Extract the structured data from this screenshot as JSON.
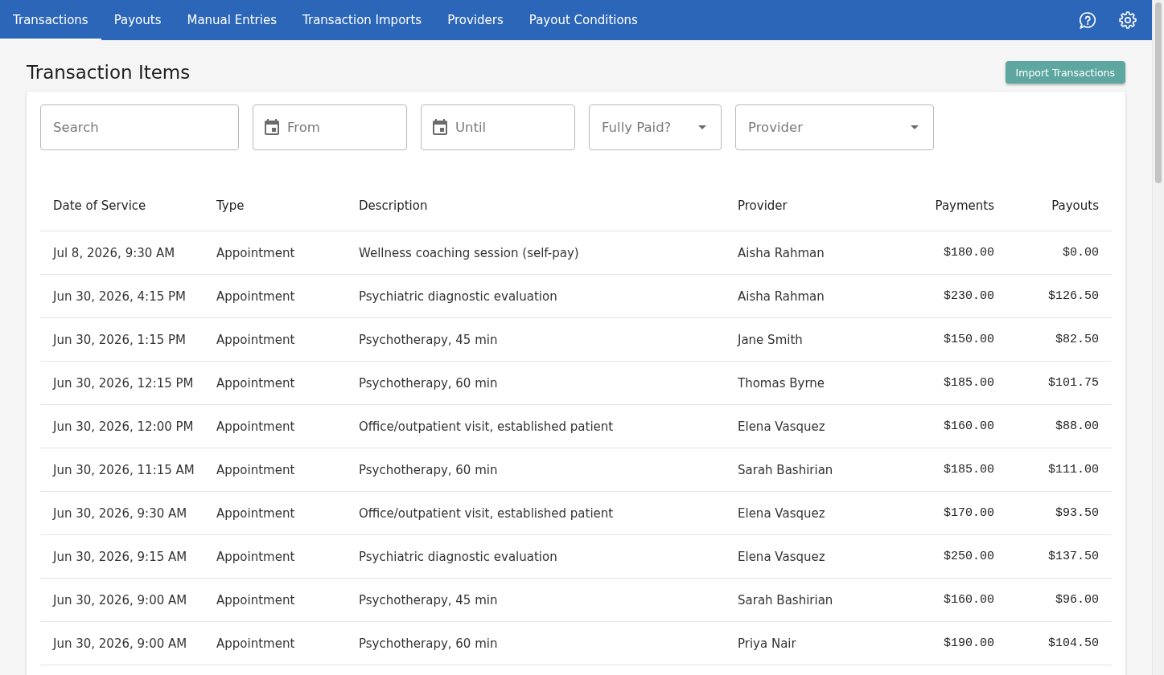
{
  "nav": {
    "tabs": [
      {
        "label": "Transactions",
        "selected": true
      },
      {
        "label": "Payouts",
        "selected": false
      },
      {
        "label": "Manual Entries",
        "selected": false
      },
      {
        "label": "Transaction Imports",
        "selected": false
      },
      {
        "label": "Providers",
        "selected": false
      },
      {
        "label": "Payout Conditions",
        "selected": false
      }
    ]
  },
  "page": {
    "title": "Transaction Items",
    "import_button": "Import Transactions"
  },
  "filters": [
    {
      "kind": "text",
      "placeholder": "Search"
    },
    {
      "kind": "date",
      "placeholder": "From"
    },
    {
      "kind": "date",
      "placeholder": "Until"
    },
    {
      "kind": "select",
      "placeholder": "Fully Paid?"
    },
    {
      "kind": "select",
      "placeholder": "Provider"
    }
  ],
  "table": {
    "columns": [
      {
        "label": "Date of Service",
        "kind": "text"
      },
      {
        "label": "Type",
        "kind": "text"
      },
      {
        "label": "Description",
        "kind": "text"
      },
      {
        "label": "Provider",
        "kind": "text"
      },
      {
        "label": "Payments",
        "kind": "money"
      },
      {
        "label": "Payouts",
        "kind": "money"
      }
    ],
    "rows": [
      [
        "Jul 8, 2026, 9:30 AM",
        "Appointment",
        "Wellness coaching session (self-pay)",
        "Aisha Rahman",
        "$180.00",
        "$0.00"
      ],
      [
        "Jun 30, 2026, 4:15 PM",
        "Appointment",
        "Psychiatric diagnostic evaluation",
        "Aisha Rahman",
        "$230.00",
        "$126.50"
      ],
      [
        "Jun 30, 2026, 1:15 PM",
        "Appointment",
        "Psychotherapy, 45 min",
        "Jane Smith",
        "$150.00",
        "$82.50"
      ],
      [
        "Jun 30, 2026, 12:15 PM",
        "Appointment",
        "Psychotherapy, 60 min",
        "Thomas Byrne",
        "$185.00",
        "$101.75"
      ],
      [
        "Jun 30, 2026, 12:00 PM",
        "Appointment",
        "Office/outpatient visit, established patient",
        "Elena Vasquez",
        "$160.00",
        "$88.00"
      ],
      [
        "Jun 30, 2026, 11:15 AM",
        "Appointment",
        "Psychotherapy, 60 min",
        "Sarah Bashirian",
        "$185.00",
        "$111.00"
      ],
      [
        "Jun 30, 2026, 9:30 AM",
        "Appointment",
        "Office/outpatient visit, established patient",
        "Elena Vasquez",
        "$170.00",
        "$93.50"
      ],
      [
        "Jun 30, 2026, 9:15 AM",
        "Appointment",
        "Psychiatric diagnostic evaluation",
        "Elena Vasquez",
        "$250.00",
        "$137.50"
      ],
      [
        "Jun 30, 2026, 9:00 AM",
        "Appointment",
        "Psychotherapy, 45 min",
        "Sarah Bashirian",
        "$160.00",
        "$96.00"
      ],
      [
        "Jun 30, 2026, 9:00 AM",
        "Appointment",
        "Psychotherapy, 60 min",
        "Priya Nair",
        "$190.00",
        "$104.50"
      ]
    ]
  }
}
